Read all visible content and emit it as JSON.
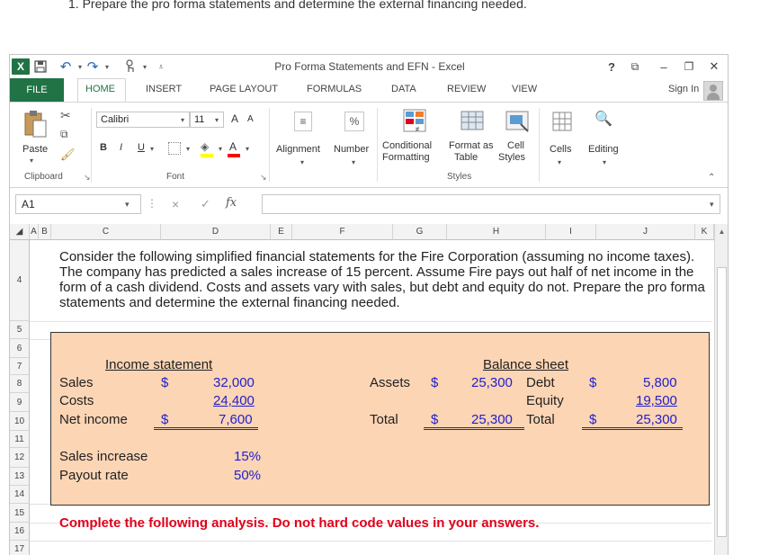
{
  "question": "1. Prepare the pro forma statements and determine the external financing needed.",
  "window": {
    "title": "Pro Forma Statements and EFN - Excel",
    "help": "?",
    "restore_icon": "⧉",
    "minimize": "–",
    "maximize": "❐",
    "close": "✕",
    "logo": "X"
  },
  "tabs": {
    "file": "FILE",
    "items": [
      "HOME",
      "INSERT",
      "PAGE LAYOUT",
      "FORMULAS",
      "DATA",
      "REVIEW",
      "VIEW"
    ],
    "sign_in": "Sign In"
  },
  "ribbon": {
    "clipboard": {
      "paste": "Paste",
      "label": "Clipboard"
    },
    "font": {
      "name": "Calibri",
      "size": "11",
      "bold": "B",
      "italic": "I",
      "underline": "U",
      "grow": "A",
      "shrink": "A",
      "label": "Font"
    },
    "alignment": "Alignment",
    "number": "Number",
    "percent": "%",
    "styles": {
      "conditional_line1": "Conditional",
      "conditional_line2": "Formatting",
      "format_as_line1": "Format as",
      "format_as_line2": "Table",
      "cell_line1": "Cell",
      "cell_line2": "Styles",
      "label": "Styles"
    },
    "cells": "Cells",
    "editing": "Editing"
  },
  "formula_bar": {
    "name_box": "A1",
    "cancel": "×",
    "enter": "✓",
    "fx": "fx"
  },
  "columns": [
    "A",
    "B",
    "C",
    "D",
    "E",
    "F",
    "G",
    "H",
    "I",
    "J",
    "K"
  ],
  "rows": [
    "4",
    "5",
    "6",
    "7",
    "8",
    "9",
    "10",
    "11",
    "12",
    "13",
    "14",
    "15",
    "16",
    "17"
  ],
  "sheet": {
    "intro": "Consider the following simplified financial statements for the Fire Corporation (assuming no income taxes). The company has predicted a sales increase of 15 percent. Assume Fire pays out half of net income in the form of a cash dividend. Costs and assets vary with sales, but debt and equity do not. Prepare the pro forma statements and determine the external financing needed.",
    "income_statement": {
      "heading": "Income statement",
      "sales_label": "Sales",
      "sales_dollar": "$",
      "sales_value": "32,000",
      "costs_label": "Costs",
      "costs_value": "24,400",
      "net_income_label": "Net income",
      "net_income_dollar": "$",
      "net_income_value": "7,600"
    },
    "balance_sheet": {
      "heading": "Balance sheet",
      "assets_label": "Assets",
      "assets_dollar": "$",
      "assets_value": "25,300",
      "debt_label": "Debt",
      "debt_dollar": "$",
      "debt_value": "5,800",
      "equity_label": "Equity",
      "equity_value": "19,500",
      "total_label": "Total",
      "total_dollar": "$",
      "total_value": "25,300",
      "total2_label": "Total",
      "total2_dollar": "$",
      "total2_value": "25,300"
    },
    "assumptions": {
      "sales_increase_label": "Sales increase",
      "sales_increase_value": "15%",
      "payout_label": "Payout rate",
      "payout_value": "50%"
    },
    "instruction": "Complete the following analysis. Do not hard code values in your answers."
  },
  "colors": {
    "accent": "#217346",
    "box_fill": "#fcd5b5",
    "input_blue": "#1f1fcc",
    "instruction_red": "#e0001b"
  }
}
